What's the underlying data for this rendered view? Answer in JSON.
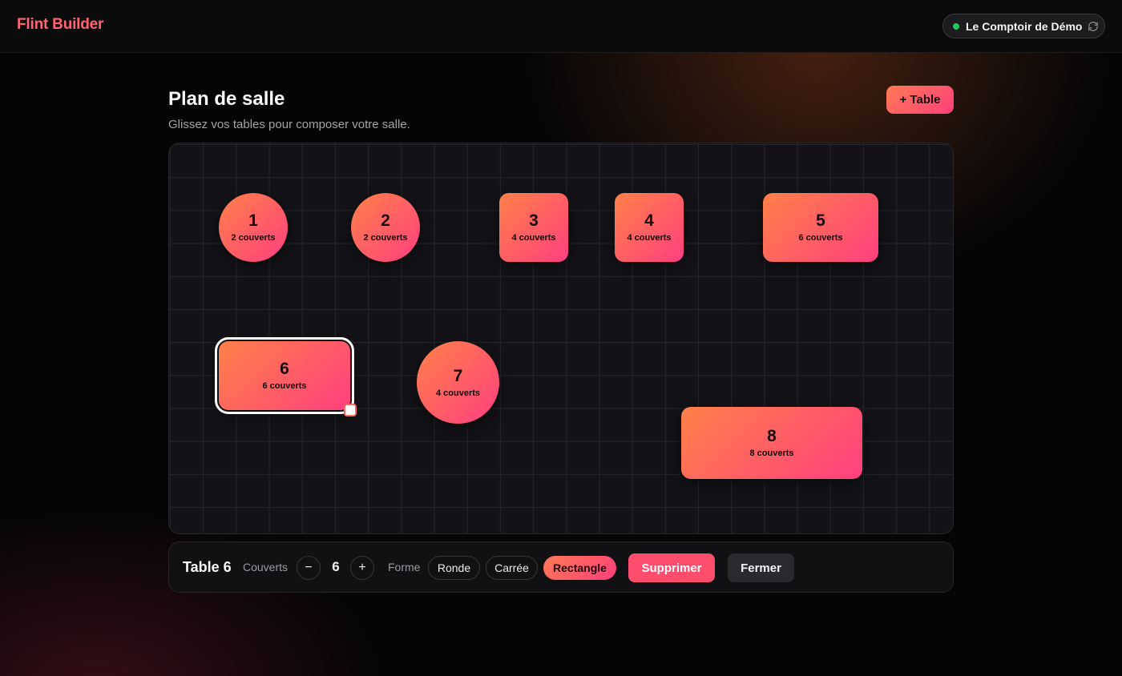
{
  "app": {
    "brand": "Flint Builder"
  },
  "header": {
    "restaurant_name": "Le Comptoir de Démo",
    "status_icon": "online-dot",
    "refresh_icon": "refresh-icon"
  },
  "page": {
    "title": "Plan de salle",
    "subtitle": "Glissez vos tables pour composer votre salle.",
    "add_table_label": "+ Table"
  },
  "floor_plan": {
    "tables": [
      {
        "number": "1",
        "seats_label": "2 couverts",
        "shape": "round"
      },
      {
        "number": "2",
        "seats_label": "2 couverts",
        "shape": "round"
      },
      {
        "number": "3",
        "seats_label": "4 couverts",
        "shape": "square"
      },
      {
        "number": "4",
        "seats_label": "4 couverts",
        "shape": "square"
      },
      {
        "number": "5",
        "seats_label": "6 couverts",
        "shape": "rectangle"
      },
      {
        "number": "6",
        "seats_label": "6 couverts",
        "shape": "rectangle",
        "selected": true
      },
      {
        "number": "7",
        "seats_label": "4 couverts",
        "shape": "round"
      },
      {
        "number": "8",
        "seats_label": "8 couverts",
        "shape": "rectangle"
      }
    ]
  },
  "inspector": {
    "title": "Table 6",
    "seats_label": "Couverts",
    "decrement_label": "−",
    "seats_value": "6",
    "increment_label": "+",
    "shape_label": "Forme",
    "shape_options": [
      "Ronde",
      "Carrée",
      "Rectangle"
    ],
    "selected_shape": "Rectangle",
    "delete_label": "Supprimer",
    "close_label": "Fermer"
  },
  "colors": {
    "brand": "#ff6470",
    "accent_gradient_start": "#ff7a55",
    "accent_gradient_end": "#ff3f7a",
    "status_online": "#22c55e",
    "danger": "#ff4d6d"
  }
}
